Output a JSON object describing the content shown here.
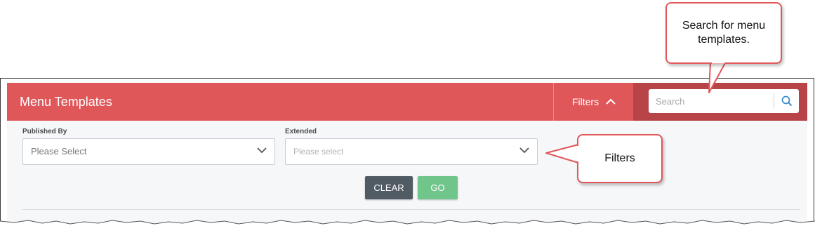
{
  "header": {
    "title": "Menu Templates",
    "filters_label": "Filters",
    "accent_color": "#e0575a",
    "search_zone_color": "#b94448"
  },
  "search": {
    "placeholder": "Search",
    "icon": "search-icon"
  },
  "filters": {
    "published_by": {
      "label": "Published By",
      "value": "Please Select"
    },
    "extended": {
      "label": "Extended",
      "value": "Please select"
    }
  },
  "buttons": {
    "clear_label": "CLEAR",
    "go_label": "GO",
    "clear_color": "#515b63",
    "go_color": "#70c58a"
  },
  "callouts": {
    "search_text": "Search for menu templates.",
    "filters_text": "Filters",
    "border_color": "#e1575a"
  }
}
